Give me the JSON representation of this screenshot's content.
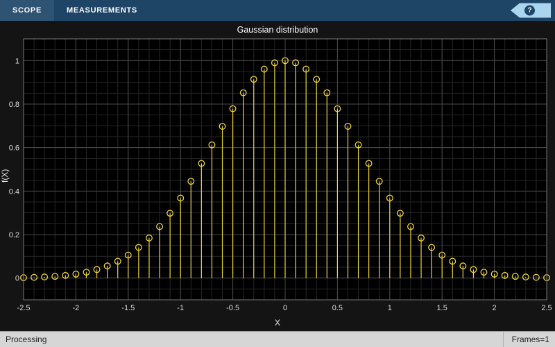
{
  "toolbar": {
    "tabs": [
      {
        "label": "SCOPE"
      },
      {
        "label": "MEASUREMENTS"
      }
    ],
    "help_label": "?"
  },
  "statusbar": {
    "left": "Processing",
    "right": "Frames=1"
  },
  "colors": {
    "toolbar_bg": "#1e4566",
    "help_bg": "#a9d5ef",
    "figure_bg": "#141414",
    "status_bg": "#d6d6d6",
    "series_yellow": "#f0d43a"
  },
  "chart_data": {
    "type": "stem",
    "title": "Gaussian distribution",
    "xlabel": "X",
    "ylabel": "f(X)",
    "xlim": [
      -2.5,
      2.5
    ],
    "ylim": [
      -0.1,
      1.1
    ],
    "x_ticks": [
      -2.5,
      -2,
      -1.5,
      -1,
      -0.5,
      0,
      0.5,
      1,
      1.5,
      2,
      2.5
    ],
    "x_tick_labels": [
      "-2.5",
      "-2",
      "-1.5",
      "-1",
      "-0.5",
      "0",
      "0.5",
      "1",
      "1.5",
      "2",
      "2.5"
    ],
    "y_ticks": [
      0,
      0.2,
      0.4,
      0.6,
      0.8,
      1
    ],
    "y_tick_labels": [
      "0",
      "0.2",
      "0.4",
      "0.6",
      "0.8",
      "1"
    ],
    "grid": true,
    "legend": "none",
    "plot_bg": "#000000",
    "grid_major_color": "#4a4a4a",
    "grid_minor_color": "#262626",
    "axis_color": "#7a7a7a",
    "tick_label_color": "#dcdcdc",
    "series": [
      {
        "name": "f(X)",
        "color": "#f0d43a",
        "marker": "circle",
        "x": [
          -2.5,
          -2.4,
          -2.3,
          -2.2,
          -2.1,
          -2.0,
          -1.9,
          -1.8,
          -1.7,
          -1.6,
          -1.5,
          -1.4,
          -1.3,
          -1.2,
          -1.1,
          -1.0,
          -0.9,
          -0.8,
          -0.7,
          -0.6,
          -0.5,
          -0.4,
          -0.3,
          -0.2,
          -0.1,
          0,
          0.1,
          0.2,
          0.3,
          0.4,
          0.5,
          0.6,
          0.7,
          0.8,
          0.9,
          1.0,
          1.1,
          1.2,
          1.3,
          1.4,
          1.5,
          1.6,
          1.7,
          1.8,
          1.9,
          2.0,
          2.1,
          2.2,
          2.3,
          2.4,
          2.5
        ],
        "y": [
          0.0019,
          0.0032,
          0.005,
          0.0079,
          0.0122,
          0.0183,
          0.027,
          0.0392,
          0.0556,
          0.0773,
          0.1054,
          0.1409,
          0.1845,
          0.2369,
          0.2982,
          0.3679,
          0.4449,
          0.5273,
          0.6126,
          0.6977,
          0.7788,
          0.8521,
          0.9139,
          0.9608,
          0.99,
          1,
          0.99,
          0.9608,
          0.9139,
          0.8521,
          0.7788,
          0.6977,
          0.6126,
          0.5273,
          0.4449,
          0.3679,
          0.2982,
          0.2369,
          0.1845,
          0.1409,
          0.1054,
          0.0773,
          0.0556,
          0.0392,
          0.027,
          0.0183,
          0.0122,
          0.0079,
          0.005,
          0.0032,
          0.0019
        ]
      }
    ]
  }
}
